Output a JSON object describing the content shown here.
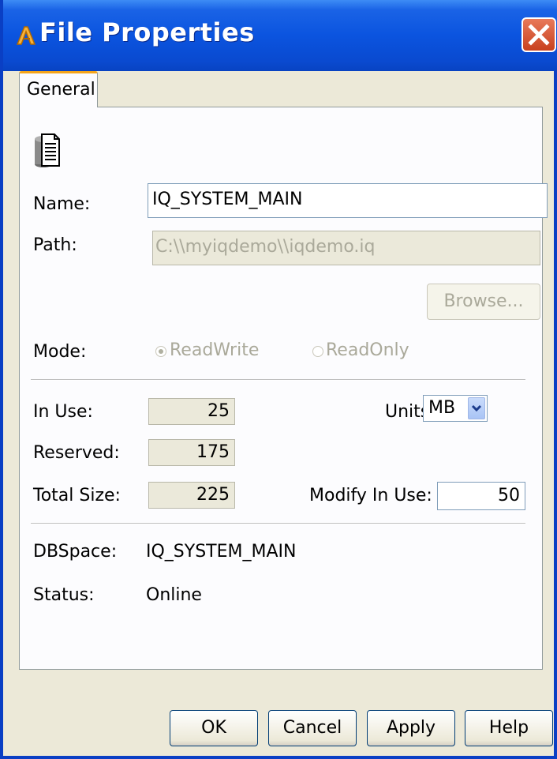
{
  "window": {
    "title": "File Properties"
  },
  "tabs": [
    {
      "label": "General"
    }
  ],
  "form": {
    "name_label": "Name:",
    "name_value": "IQ_SYSTEM_MAIN",
    "path_label": "Path:",
    "path_value": "C:\\\\myiqdemo\\\\iqdemo.iq",
    "browse_label": "Browse...",
    "mode_label": "Mode:",
    "mode_options": [
      {
        "label": "ReadWrite",
        "selected": true
      },
      {
        "label": "ReadOnly",
        "selected": false
      }
    ],
    "in_use_label": "In Use:",
    "in_use_value": "25",
    "reserved_label": "Reserved:",
    "reserved_value": "175",
    "total_size_label": "Total Size:",
    "total_size_value": "225",
    "units_label": "Units:",
    "units_value": "MB",
    "modify_in_use_label": "Modify In Use:",
    "modify_in_use_value": "50",
    "dbspace_label": "DBSpace:",
    "dbspace_value": "IQ_SYSTEM_MAIN",
    "status_label": "Status:",
    "status_value": "Online"
  },
  "buttons": {
    "ok": "OK",
    "cancel": "Cancel",
    "apply": "Apply",
    "help": "Help"
  },
  "colors": {
    "titlebar": "#0b54df",
    "close": "#c8401e",
    "tab_accent": "#f5a51a",
    "face": "#ece9d8"
  },
  "icons": {
    "app": "app-logo-icon",
    "close": "close-icon",
    "file": "database-file-icon",
    "dropdown": "chevron-down-icon"
  }
}
